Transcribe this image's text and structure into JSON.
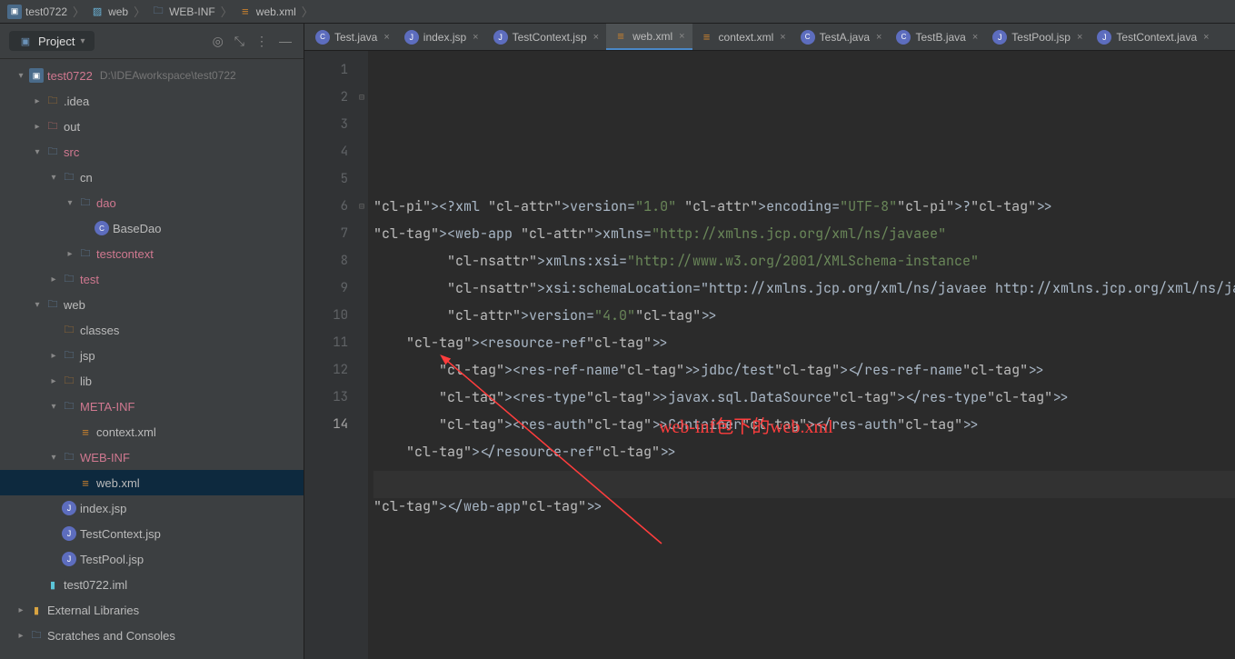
{
  "breadcrumb": [
    {
      "icon": "mod",
      "label": "test0722"
    },
    {
      "icon": "img",
      "label": "web"
    },
    {
      "icon": "fold",
      "label": "WEB-INF"
    },
    {
      "icon": "xml",
      "label": "web.xml"
    }
  ],
  "project_label": "Project",
  "tree": [
    {
      "d": 0,
      "tw": "v",
      "ic": "mod",
      "name": "test0722",
      "hl": true,
      "path": "D:\\IDEAworkspace\\test0722"
    },
    {
      "d": 1,
      "tw": ">",
      "ic": "fold-o",
      "name": ".idea"
    },
    {
      "d": 1,
      "tw": ">",
      "ic": "fold-r",
      "name": "out"
    },
    {
      "d": 1,
      "tw": "v",
      "ic": "fold-b",
      "name": "src",
      "hl": true
    },
    {
      "d": 2,
      "tw": "v",
      "ic": "fold-b",
      "name": "cn"
    },
    {
      "d": 3,
      "tw": "v",
      "ic": "fold-b",
      "name": "dao",
      "hl": true
    },
    {
      "d": 4,
      "tw": "",
      "ic": "java",
      "name": "BaseDao"
    },
    {
      "d": 3,
      "tw": ">",
      "ic": "fold-b",
      "name": "testcontext",
      "hl": true
    },
    {
      "d": 2,
      "tw": ">",
      "ic": "fold-b",
      "name": "test",
      "hl": true
    },
    {
      "d": 1,
      "tw": "v",
      "ic": "fold-b",
      "name": "web"
    },
    {
      "d": 2,
      "tw": "",
      "ic": "fold-o",
      "name": "classes"
    },
    {
      "d": 2,
      "tw": ">",
      "ic": "fold",
      "name": "jsp"
    },
    {
      "d": 2,
      "tw": ">",
      "ic": "fold-o",
      "name": "lib"
    },
    {
      "d": 2,
      "tw": "v",
      "ic": "fold-b",
      "name": "META-INF",
      "hl": true
    },
    {
      "d": 3,
      "tw": "",
      "ic": "xml",
      "name": "context.xml"
    },
    {
      "d": 2,
      "tw": "v",
      "ic": "fold-b",
      "name": "WEB-INF",
      "hl": true
    },
    {
      "d": 3,
      "tw": "",
      "ic": "xml",
      "name": "web.xml",
      "sel": true
    },
    {
      "d": 2,
      "tw": "",
      "ic": "jsp",
      "name": "index.jsp"
    },
    {
      "d": 2,
      "tw": "",
      "ic": "jsp",
      "name": "TestContext.jsp"
    },
    {
      "d": 2,
      "tw": "",
      "ic": "jsp",
      "name": "TestPool.jsp"
    },
    {
      "d": 1,
      "tw": "",
      "ic": "ij",
      "name": "test0722.iml"
    },
    {
      "d": -1,
      "tw": ">",
      "ic": "lib",
      "name": "External Libraries"
    },
    {
      "d": -1,
      "tw": ">",
      "ic": "fold",
      "name": "Scratches and Consoles"
    }
  ],
  "tabs": [
    {
      "ic": "java",
      "label": "Test.java"
    },
    {
      "ic": "jsp",
      "label": "index.jsp"
    },
    {
      "ic": "jsp",
      "label": "TestContext.jsp"
    },
    {
      "ic": "xml",
      "label": "web.xml",
      "active": true
    },
    {
      "ic": "xml",
      "label": "context.xml"
    },
    {
      "ic": "java",
      "label": "TestA.java"
    },
    {
      "ic": "java",
      "label": "TestB.java"
    },
    {
      "ic": "jsp",
      "label": "TestPool.jsp"
    },
    {
      "ic": "jsp",
      "label": "TestContext.java"
    }
  ],
  "code": {
    "lines": [
      "<?xml version=\"1.0\" encoding=\"UTF-8\"?>",
      "<web-app xmlns=\"http://xmlns.jcp.org/xml/ns/javaee\"",
      "         xmlns:xsi=\"http://www.w3.org/2001/XMLSchema-instance\"",
      "         xsi:schemaLocation=\"http://xmlns.jcp.org/xml/ns/javaee http://xmlns.jcp.org/xml/ns/jav",
      "         version=\"4.0\">",
      "    <resource-ref>",
      "        <res-ref-name>jdbc/test</res-ref-name>",
      "        <res-type>javax.sql.DataSource</res-type>",
      "        <res-auth>Container</res-auth>",
      "    </resource-ref>",
      "",
      "</web-app>",
      "",
      ""
    ],
    "line_count": 14,
    "current_line": 14
  },
  "annotation": "web-inf包下的web.xml"
}
